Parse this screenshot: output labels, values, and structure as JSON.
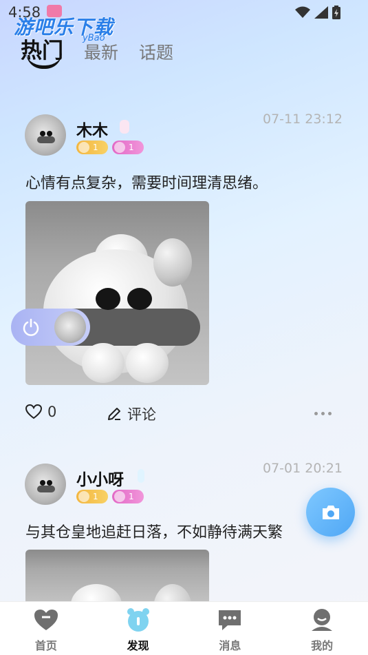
{
  "status_bar": {
    "time": "4:58",
    "icons": [
      "notification-icon",
      "wifi-icon",
      "signal-icon",
      "battery-icon"
    ]
  },
  "watermark": {
    "text": "游吧乐下载",
    "sub": "yBao"
  },
  "tabs": [
    {
      "label": "热门",
      "active": true
    },
    {
      "label": "最新",
      "active": false
    },
    {
      "label": "话题",
      "active": false
    }
  ],
  "posts": [
    {
      "username": "木木",
      "level_badge": "1",
      "vip_badge": "1",
      "time": "07-11 23:12",
      "text": "心情有点复杂，需要时间理清思绪。",
      "likes": "0",
      "comment_label": "评论"
    },
    {
      "username": "小小呀",
      "level_badge": "1",
      "vip_badge": "1",
      "time": "07-01 20:21",
      "text": "与其仓皇地追赶日落，不如静待满天繁"
    }
  ],
  "bottom_nav": [
    {
      "label": "首页",
      "icon": "home-icon"
    },
    {
      "label": "发现",
      "icon": "discover-icon",
      "active": true
    },
    {
      "label": "消息",
      "icon": "message-icon"
    },
    {
      "label": "我的",
      "icon": "profile-icon"
    }
  ],
  "colors": {
    "accent": "#4fa7f5",
    "active_nav": "#7fd3f0",
    "gold_badge": "#f3b63f",
    "pink_badge": "#e268c6"
  }
}
